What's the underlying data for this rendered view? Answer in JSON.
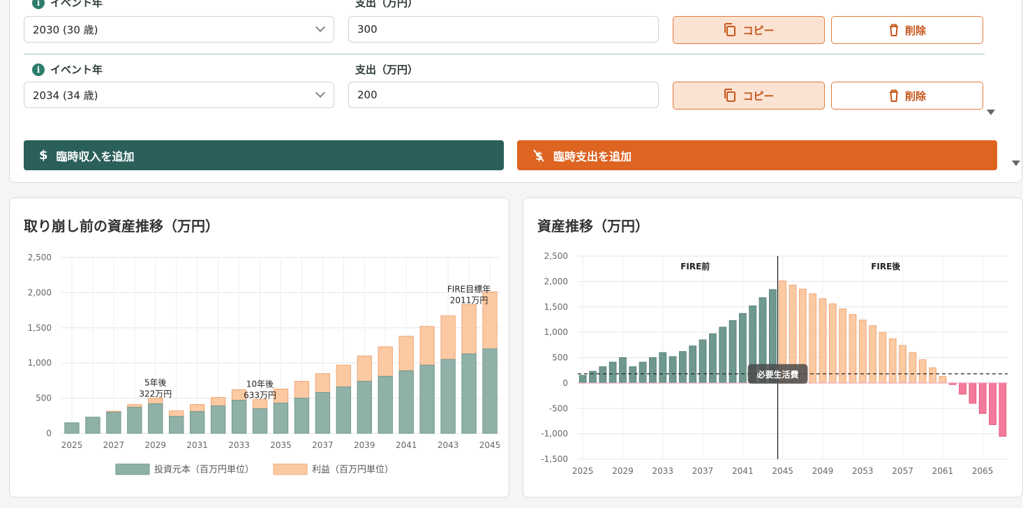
{
  "events": [
    {
      "year_label": "イベント年",
      "year_value": "2030 (30 歳)",
      "expense_label": "支出（万円）",
      "expense_value": "300",
      "copy_label": "コピー",
      "delete_label": "削除"
    },
    {
      "year_label": "イベント年",
      "year_value": "2034 (34 歳)",
      "expense_label": "支出（万円）",
      "expense_value": "200",
      "copy_label": "コピー",
      "delete_label": "削除"
    }
  ],
  "buttons": {
    "add_income": "臨時収入を追加",
    "add_expense": "臨時支出を追加"
  },
  "icons": {
    "info": "info-icon",
    "copy": "copy-icon",
    "delete": "trash-icon",
    "income": "dollar-icon",
    "expense": "dollar-off-icon"
  },
  "colors": {
    "principal": "#8fb1a7",
    "profit": "#fbc9a2",
    "asset_before": "#6f998f",
    "asset_after": "#fbc9a2",
    "negative": "#f47a9b",
    "income_button": "#2a5f5a",
    "expense_button": "#dd6421"
  },
  "chart_data": [
    {
      "title": "取り崩し前の資産推移（万円）",
      "type": "bar",
      "stacked": true,
      "categories": [
        "2025",
        "2026",
        "2027",
        "2028",
        "2029",
        "2030",
        "2031",
        "2032",
        "2033",
        "2034",
        "2035",
        "2036",
        "2037",
        "2038",
        "2039",
        "2040",
        "2041",
        "2042",
        "2043",
        "2044",
        "2045"
      ],
      "x_tick_labels": [
        "2025",
        "2027",
        "2029",
        "2031",
        "2033",
        "2035",
        "2037",
        "2039",
        "2041",
        "2043",
        "2045"
      ],
      "ylim": [
        0,
        2500
      ],
      "y_ticks": [
        0,
        500,
        1000,
        1500,
        2000,
        2500
      ],
      "y_tick_labels": [
        "0",
        "500",
        "1,000",
        "1,500",
        "2,000",
        "2,500"
      ],
      "series": [
        {
          "name": "投資元本（百万円単位）",
          "values": [
            150,
            230,
            300,
            370,
            420,
            240,
            310,
            390,
            470,
            350,
            430,
            500,
            580,
            660,
            740,
            810,
            890,
            970,
            1050,
            1130,
            1200
          ]
        },
        {
          "name": "利益（百万円単位）",
          "values": [
            0,
            0,
            15,
            40,
            80,
            80,
            100,
            120,
            150,
            130,
            200,
            240,
            270,
            310,
            360,
            420,
            490,
            550,
            620,
            700,
            811
          ]
        }
      ],
      "annotations": [
        {
          "year": "2029",
          "lines": [
            "5年後",
            "322万円"
          ]
        },
        {
          "year": "2034",
          "lines": [
            "10年後",
            "633万円"
          ]
        },
        {
          "year": "2044",
          "lines": [
            "FIRE目標年",
            "2011万円"
          ]
        }
      ],
      "grid": true,
      "legend_position": "bottom"
    },
    {
      "title": "資産推移（万円）",
      "type": "bar",
      "x": [
        2025,
        2026,
        2027,
        2028,
        2029,
        2030,
        2031,
        2032,
        2033,
        2034,
        2035,
        2036,
        2037,
        2038,
        2039,
        2040,
        2041,
        2042,
        2043,
        2044,
        2045,
        2046,
        2047,
        2048,
        2049,
        2050,
        2051,
        2052,
        2053,
        2054,
        2055,
        2056,
        2057,
        2058,
        2059,
        2060,
        2061,
        2062,
        2063,
        2064,
        2065,
        2066
      ],
      "x_tick_labels": [
        "2025",
        "2029",
        "2033",
        "2037",
        "2041",
        "2045",
        "2049",
        "2053",
        "2057",
        "2061",
        "2065"
      ],
      "ylim": [
        -1500,
        2500
      ],
      "y_ticks": [
        -1500,
        -1000,
        -500,
        0,
        500,
        1000,
        1500,
        2000,
        2500
      ],
      "y_tick_labels": [
        "-1,500",
        "-1,000",
        "-500",
        "0",
        "500",
        "1,000",
        "1,500",
        "2,000",
        "2,500"
      ],
      "values": [
        150,
        230,
        320,
        410,
        500,
        320,
        410,
        500,
        600,
        520,
        620,
        730,
        850,
        970,
        1100,
        1230,
        1370,
        1520,
        1680,
        1840,
        2011,
        1930,
        1850,
        1760,
        1660,
        1560,
        1460,
        1350,
        1240,
        1130,
        1000,
        870,
        740,
        600,
        460,
        300,
        130,
        -30,
        -220,
        -400,
        -600,
        -820,
        -1050
      ],
      "fire_year": 2044,
      "region_labels": [
        "FIRE前",
        "FIRE後"
      ],
      "living_cost_line": 180,
      "living_cost_label": "必要生活費",
      "grid": true
    }
  ]
}
